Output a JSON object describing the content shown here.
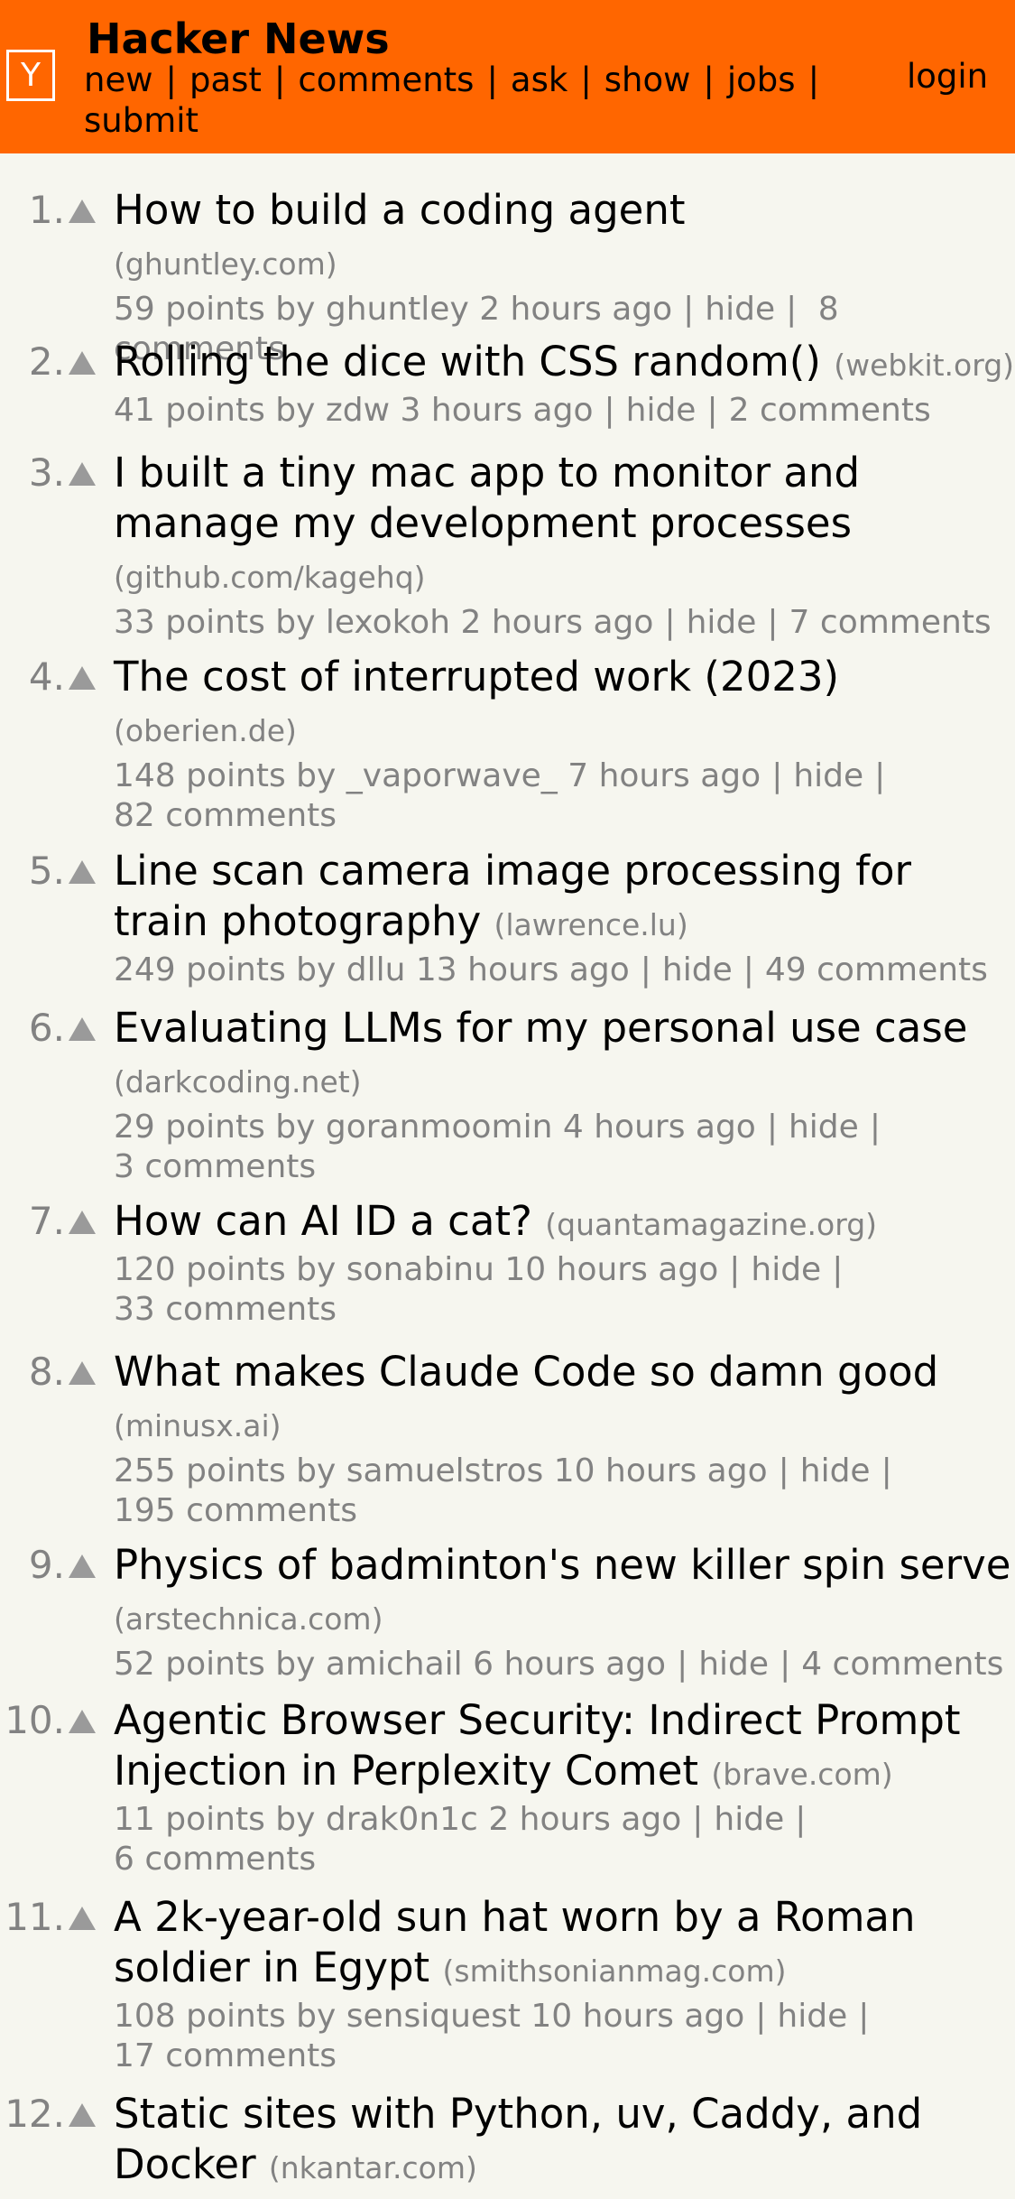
{
  "header": {
    "logo": "Y",
    "title": "Hacker News",
    "nav": [
      "new",
      "past",
      "comments",
      "ask",
      "show",
      "jobs",
      "submit"
    ],
    "login": "login"
  },
  "stories": [
    {
      "rank": "1.",
      "title": "How to build a coding agent",
      "site": "(ghuntley.com)",
      "points": "59 points",
      "user": "ghuntley",
      "age": "2 hours ago",
      "hide": "hide",
      "comments": "8 comments"
    },
    {
      "rank": "2.",
      "title": "Rolling the dice with CSS random()",
      "site": "(webkit.org)",
      "points": "41 points",
      "user": "zdw",
      "age": "3 hours ago",
      "hide": "hide",
      "comments": "2 comments"
    },
    {
      "rank": "3.",
      "title": "I built a tiny mac app to monitor and manage my development processes",
      "site": "(github.com/kagehq)",
      "points": "33 points",
      "user": "lexokoh",
      "age": "2 hours ago",
      "hide": "hide",
      "comments": "7 comments"
    },
    {
      "rank": "4.",
      "title": "The cost of interrupted work (2023)",
      "site": "(oberien.de)",
      "points": "148 points",
      "user": "_vaporwave_",
      "age": "7 hours ago",
      "hide": "hide",
      "comments": "82 comments"
    },
    {
      "rank": "5.",
      "title": "Line scan camera image processing for train photography",
      "site": "(lawrence.lu)",
      "points": "249 points",
      "user": "dllu",
      "age": "13 hours ago",
      "hide": "hide",
      "comments": "49 comments"
    },
    {
      "rank": "6.",
      "title": "Evaluating LLMs for my personal use case",
      "site": "(darkcoding.net)",
      "points": "29 points",
      "user": "goranmoomin",
      "age": "4 hours ago",
      "hide": "hide",
      "comments": "3 comments"
    },
    {
      "rank": "7.",
      "title": "How can AI ID a cat?",
      "site": "(quantamagazine.org)",
      "points": "120 points",
      "user": "sonabinu",
      "age": "10 hours ago",
      "hide": "hide",
      "comments": "33 comments"
    },
    {
      "rank": "8.",
      "title": "What makes Claude Code so damn good",
      "site": "(minusx.ai)",
      "points": "255 points",
      "user": "samuelstros",
      "age": "10 hours ago",
      "hide": "hide",
      "comments": "195 comments"
    },
    {
      "rank": "9.",
      "title": "Physics of badminton's new killer spin serve",
      "site": "(arstechnica.com)",
      "points": "52 points",
      "user": "amichail",
      "age": "6 hours ago",
      "hide": "hide",
      "comments": "4 comments"
    },
    {
      "rank": "10.",
      "title": "Agentic Browser Security: Indirect Prompt Injection in Perplexity Comet",
      "site": "(brave.com)",
      "points": "11 points",
      "user": "drak0n1c",
      "age": "2 hours ago",
      "hide": "hide",
      "comments": "6 comments"
    },
    {
      "rank": "11.",
      "title": "A 2k-year-old sun hat worn by a Roman soldier in Egypt",
      "site": "(smithsonianmag.com)",
      "points": "108 points",
      "user": "sensiquest",
      "age": "10 hours ago",
      "hide": "hide",
      "comments": "17 comments"
    },
    {
      "rank": "12.",
      "title": "Static sites with Python, uv, Caddy, and Docker",
      "site": "(nkantar.com)"
    }
  ]
}
